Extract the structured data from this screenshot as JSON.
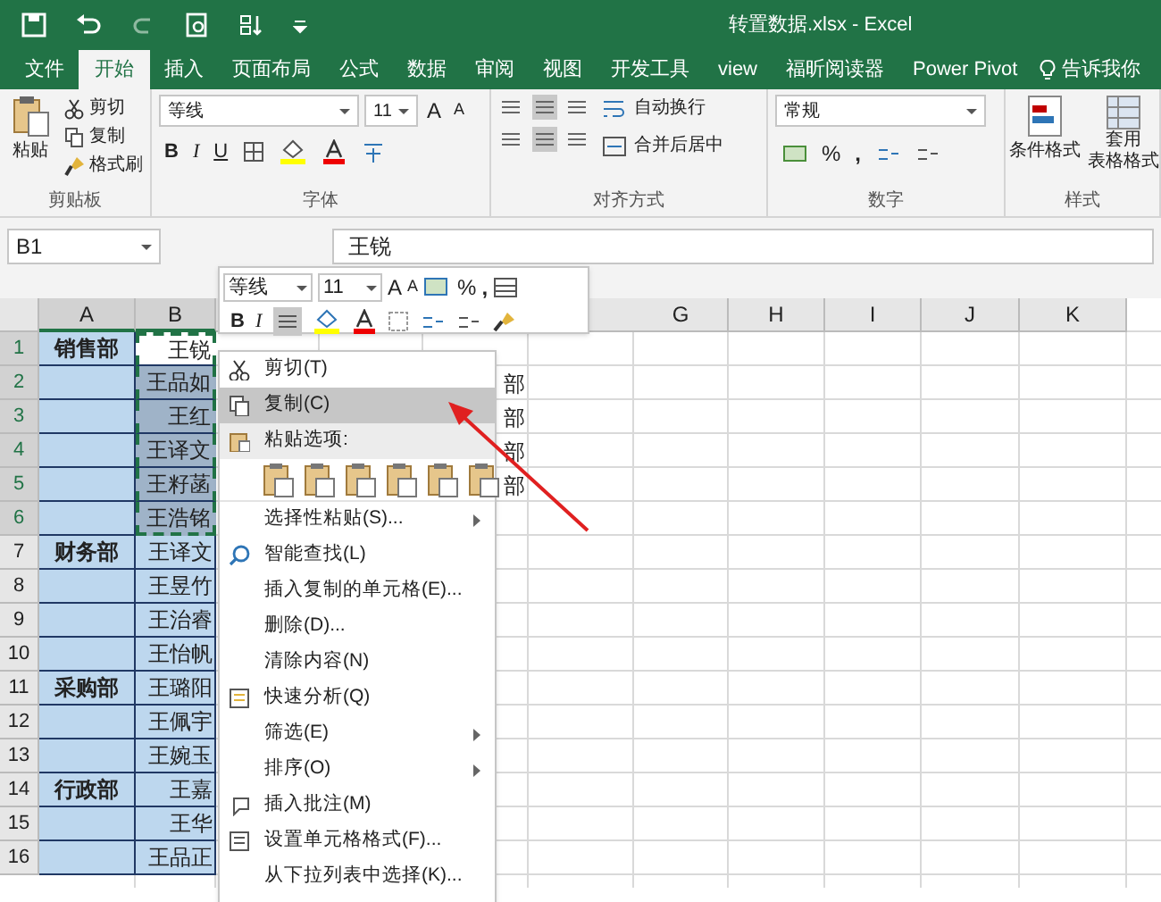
{
  "window": {
    "title": "转置数据.xlsx  -  Excel"
  },
  "tabs": [
    {
      "label": "文件",
      "selected": false
    },
    {
      "label": "开始",
      "selected": true
    },
    {
      "label": "插入",
      "selected": false
    },
    {
      "label": "页面布局",
      "selected": false
    },
    {
      "label": "公式",
      "selected": false
    },
    {
      "label": "数据",
      "selected": false
    },
    {
      "label": "审阅",
      "selected": false
    },
    {
      "label": "视图",
      "selected": false
    },
    {
      "label": "开发工具",
      "selected": false
    },
    {
      "label": "view",
      "selected": false
    },
    {
      "label": "福昕阅读器",
      "selected": false
    },
    {
      "label": "Power Pivot",
      "selected": false
    }
  ],
  "tell_me": "告诉我你",
  "ribbon": {
    "clipboard": {
      "paste": "粘贴",
      "cut": "剪切",
      "copy": "复制",
      "format_painter": "格式刷",
      "label": "剪贴板"
    },
    "font": {
      "font_name": "等线",
      "font_size": "11",
      "grow": "A",
      "shrink": "A",
      "bold": "B",
      "italic": "I",
      "underline": "U",
      "label": "字体"
    },
    "alignment": {
      "wrap": "自动换行",
      "merge": "合并后居中",
      "label": "对齐方式"
    },
    "number": {
      "format": "常规",
      "percent": "%",
      "comma": ",",
      "label": "数字"
    },
    "styles": {
      "conditional": "条件格式",
      "table_1": "套用",
      "table_2": "表格格式",
      "label": "样式"
    }
  },
  "formula_bar": {
    "name_box": "B1",
    "value": "王锐"
  },
  "mini_toolbar": {
    "font_name": "等线",
    "font_size": "11",
    "grow": "A",
    "shrink": "A",
    "percent": "%",
    "comma": ",",
    "bold": "B",
    "italic": "I"
  },
  "columns": [
    "A",
    "B",
    "G",
    "H",
    "I",
    "J",
    "K"
  ],
  "rows": [
    {
      "number": "1",
      "dept": "销售部",
      "name": "王锐",
      "selected": true,
      "active": true
    },
    {
      "number": "2",
      "dept": "",
      "name": "王品如",
      "col_e": "部",
      "selected": true,
      "active": false
    },
    {
      "number": "3",
      "dept": "",
      "name": "王红",
      "col_e": "部",
      "selected": true,
      "active": false
    },
    {
      "number": "4",
      "dept": "",
      "name": "王译文",
      "col_e": "部",
      "selected": true,
      "active": false
    },
    {
      "number": "5",
      "dept": "",
      "name": "王籽菡",
      "col_e": "部",
      "selected": true,
      "active": false
    },
    {
      "number": "6",
      "dept": "",
      "name": "王浩铭",
      "selected": true,
      "active": false
    },
    {
      "number": "7",
      "dept": "财务部",
      "name": "王译文",
      "selected": false,
      "active": false
    },
    {
      "number": "8",
      "dept": "",
      "name": "王昱竹",
      "selected": false,
      "active": false
    },
    {
      "number": "9",
      "dept": "",
      "name": "王治睿",
      "selected": false,
      "active": false
    },
    {
      "number": "10",
      "dept": "",
      "name": "王怡帆",
      "selected": false,
      "active": false
    },
    {
      "number": "11",
      "dept": "采购部",
      "name": "王璐阳",
      "selected": false,
      "active": false
    },
    {
      "number": "12",
      "dept": "",
      "name": "王佩宇",
      "selected": false,
      "active": false
    },
    {
      "number": "13",
      "dept": "",
      "name": "王婉玉",
      "selected": false,
      "active": false
    },
    {
      "number": "14",
      "dept": "行政部",
      "name": "王嘉",
      "selected": false,
      "active": false
    },
    {
      "number": "15",
      "dept": "",
      "name": "王华",
      "selected": false,
      "active": false
    },
    {
      "number": "16",
      "dept": "",
      "name": "王品正",
      "selected": false,
      "active": false
    }
  ],
  "context_menu": [
    {
      "kind": "item",
      "label": "剪切(T)",
      "selected": false,
      "submenu": false
    },
    {
      "kind": "item",
      "label": "复制(C)",
      "selected": true,
      "submenu": false
    },
    {
      "kind": "header",
      "label": "粘贴选项:"
    },
    {
      "kind": "paste_icons"
    },
    {
      "kind": "item",
      "label": "选择性粘贴(S)...",
      "selected": false,
      "submenu": true
    },
    {
      "kind": "item",
      "label": "智能查找(L)",
      "selected": false,
      "submenu": false
    },
    {
      "kind": "item",
      "label": "插入复制的单元格(E)...",
      "selected": false,
      "submenu": false
    },
    {
      "kind": "item",
      "label": "删除(D)...",
      "selected": false,
      "submenu": false
    },
    {
      "kind": "item",
      "label": "清除内容(N)",
      "selected": false,
      "submenu": false
    },
    {
      "kind": "item",
      "label": "快速分析(Q)",
      "selected": false,
      "submenu": false
    },
    {
      "kind": "item",
      "label": "筛选(E)",
      "selected": false,
      "submenu": true
    },
    {
      "kind": "item",
      "label": "排序(O)",
      "selected": false,
      "submenu": true
    },
    {
      "kind": "item",
      "label": "插入批注(M)",
      "selected": false,
      "submenu": false
    },
    {
      "kind": "item",
      "label": "设置单元格格式(F)...",
      "selected": false,
      "submenu": false
    },
    {
      "kind": "item",
      "label": "从下拉列表中选择(K)...",
      "selected": false,
      "submenu": false
    }
  ]
}
